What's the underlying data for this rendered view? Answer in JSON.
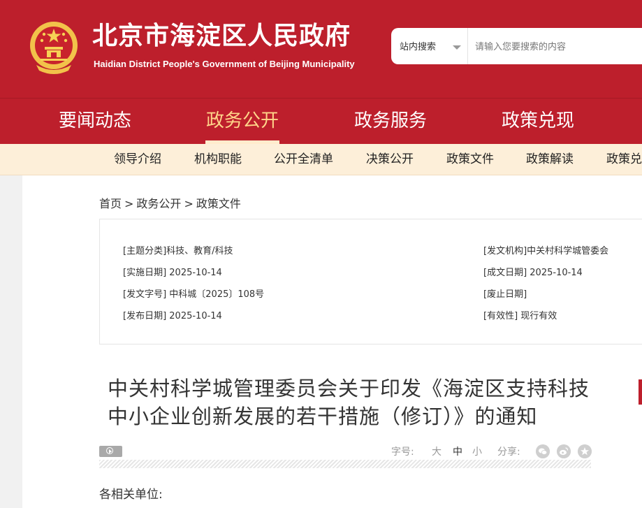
{
  "header": {
    "title": "北京市海淀区人民政府",
    "subtitle": "Haidian District People's Government of Beijing Municipality",
    "emblem_icon": "national-emblem-icon",
    "brand_color": "#bd1f2c"
  },
  "search": {
    "scope": "站内搜索",
    "placeholder": "请输入您要搜索的内容"
  },
  "main_nav": [
    {
      "label": "要闻动态"
    },
    {
      "label": "政务公开",
      "active": true
    },
    {
      "label": "政务服务"
    },
    {
      "label": "政策兑现"
    }
  ],
  "sub_nav": [
    {
      "label": "领导介绍"
    },
    {
      "label": "机构职能"
    },
    {
      "label": "公开全清单"
    },
    {
      "label": "决策公开"
    },
    {
      "label": "政策文件"
    },
    {
      "label": "政策解读"
    },
    {
      "label": "政策兑现"
    }
  ],
  "breadcrumb": [
    "首页",
    ">",
    "政务公开",
    ">",
    "政策文件"
  ],
  "info": {
    "topic": "[主题分类]科技、教育/科技",
    "issuer": "[发文机构]中关村科学城管委会",
    "effective_date": "[实施日期] 2025-10-14",
    "written_date": "[成文日期] 2025-10-14",
    "doc_number": "[发文字号] 中科城〔2025〕108号",
    "expiry_date": "[废止日期]",
    "publish_date": "[发布日期] 2025-10-14",
    "validity": "[有效性] 现行有效"
  },
  "article": {
    "title": "中关村科学城管理委员会关于印发《海淀区支持科技中小企业创新发展的若干措施（修订）》的通知",
    "salutation": "各相关单位:"
  },
  "tools": {
    "font_size_label": "字号:",
    "font_large": "大",
    "font_medium": "中",
    "font_small": "小",
    "share_label": "分享:",
    "share_icons": [
      "wechat-icon",
      "weibo-icon",
      "favorite-icon"
    ]
  }
}
